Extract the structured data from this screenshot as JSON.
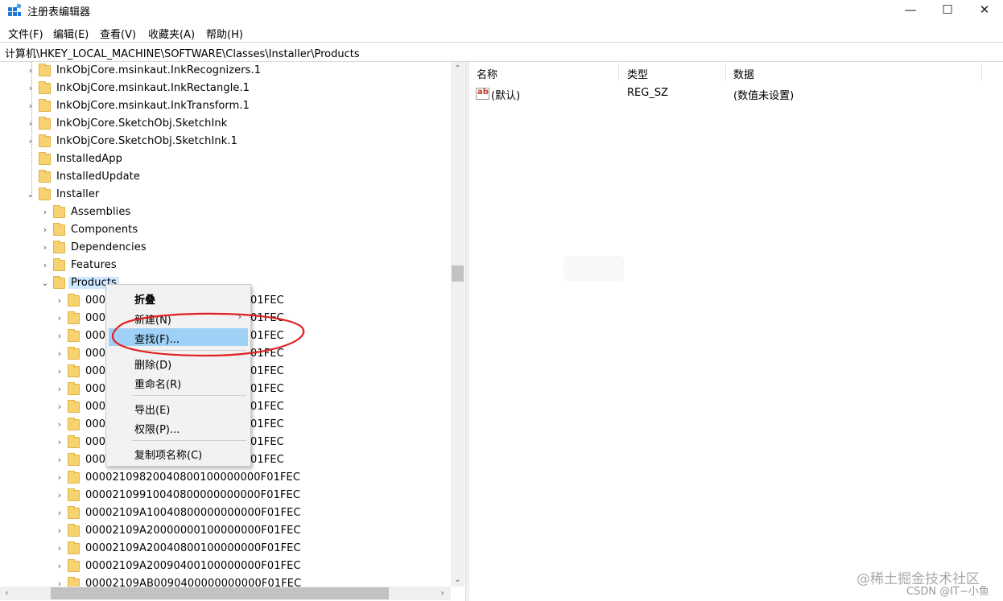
{
  "window": {
    "title": "注册表编辑器",
    "minimize": "—",
    "maximize": "☐",
    "close": "✕"
  },
  "menubar": [
    {
      "label": "文件(F)"
    },
    {
      "label": "编辑(E)"
    },
    {
      "label": "查看(V)"
    },
    {
      "label": "收藏夹(A)"
    },
    {
      "label": "帮助(H)"
    }
  ],
  "address": "计算机\\HKEY_LOCAL_MACHINE\\SOFTWARE\\Classes\\Installer\\Products",
  "tree": {
    "rows": [
      {
        "label": "InkObjCore.msinkaut.InkRecognizers.1",
        "expander": "›"
      },
      {
        "label": "InkObjCore.msinkaut.InkRectangle.1",
        "expander": "›"
      },
      {
        "label": "InkObjCore.msinkaut.InkTransform.1",
        "expander": "›"
      },
      {
        "label": "InkObjCore.SketchObj.SketchInk",
        "expander": "›"
      },
      {
        "label": "InkObjCore.SketchObj.SketchInk.1",
        "expander": "›"
      },
      {
        "label": "InstalledApp",
        "expander": ""
      },
      {
        "label": "InstalledUpdate",
        "expander": ""
      },
      {
        "label": "Installer",
        "expander": "⌄"
      },
      {
        "label": "Assemblies",
        "expander": "›"
      },
      {
        "label": "Components",
        "expander": "›"
      },
      {
        "label": "Dependencies",
        "expander": "›"
      },
      {
        "label": "Features",
        "expander": "›"
      },
      {
        "label": "Products",
        "expander": "⌄"
      },
      {
        "label": "000",
        "suffix": "01FEC",
        "expander": "›"
      },
      {
        "label": "000",
        "suffix": "01FEC",
        "expander": "›"
      },
      {
        "label": "000",
        "suffix": "01FEC",
        "expander": "›"
      },
      {
        "label": "000",
        "suffix": "01FEC",
        "expander": "›"
      },
      {
        "label": "000",
        "suffix": "01FEC",
        "expander": "›"
      },
      {
        "label": "000",
        "suffix": "01FEC",
        "expander": "›"
      },
      {
        "label": "000",
        "suffix": "01FEC",
        "expander": "›"
      },
      {
        "label": "000",
        "suffix": "01FEC",
        "expander": "›"
      },
      {
        "label": "000",
        "suffix": "01FEC",
        "expander": "›"
      },
      {
        "label": "000",
        "suffix": "01FEC",
        "expander": "›"
      },
      {
        "label": "00002109820040800100000000F01FEC",
        "expander": "›"
      },
      {
        "label": "00002109910040800000000000F01FEC",
        "expander": "›"
      },
      {
        "label": "00002109A10040800000000000F01FEC",
        "expander": "›"
      },
      {
        "label": "00002109A20000000100000000F01FEC",
        "expander": "›"
      },
      {
        "label": "00002109A20040800100000000F01FEC",
        "expander": "›"
      },
      {
        "label": "00002109A20090400100000000F01FEC",
        "expander": "›"
      },
      {
        "label": "00002109AB0090400000000000F01FEC",
        "expander": "›"
      }
    ]
  },
  "values_pane": {
    "headers": [
      "名称",
      "类型",
      "数据"
    ],
    "rows": [
      {
        "name": "(默认)",
        "type": "REG_SZ",
        "data": "(数值未设置)",
        "icon": "ab"
      }
    ]
  },
  "context_menu": {
    "items": [
      {
        "label": "折叠",
        "bold": true
      },
      {
        "label": "新建(N)",
        "submenu": "›"
      },
      {
        "label": "查找(F)...",
        "highlight": true
      },
      {
        "label": "删除(D)"
      },
      {
        "label": "重命名(R)"
      },
      {
        "label": "导出(E)"
      },
      {
        "label": "权限(P)..."
      },
      {
        "label": "复制项名称(C)"
      }
    ]
  },
  "watermark": {
    "line1": "@稀土掘金技术社区",
    "line2": "CSDN @IT~小鱼"
  },
  "colors": {
    "highlight": "#9fd0f5",
    "annotation": "#e02020",
    "folder": "#f6d271"
  }
}
